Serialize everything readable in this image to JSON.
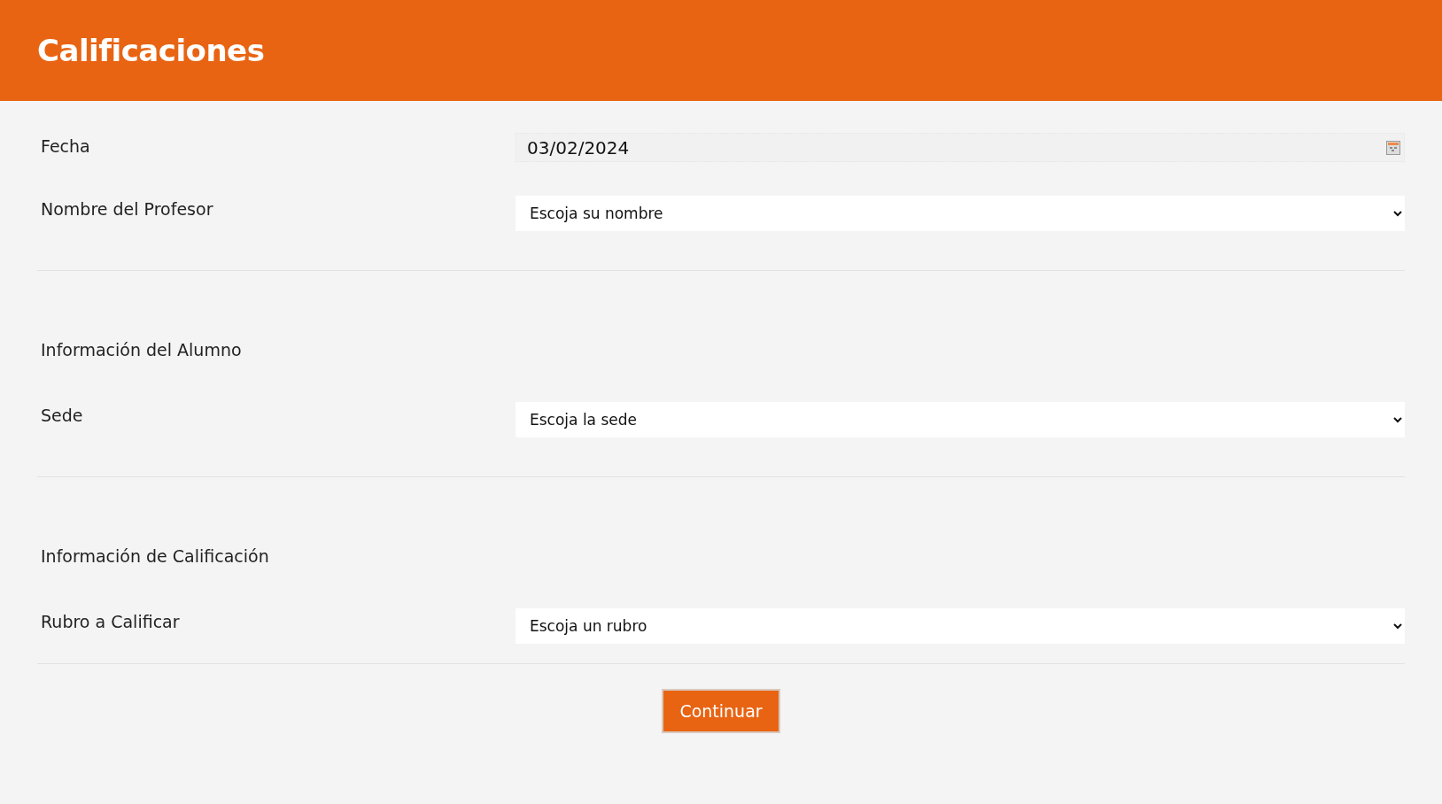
{
  "header": {
    "title": "Calificaciones"
  },
  "sections": [
    {
      "rows": [
        {
          "kind": "date",
          "label": "Fecha",
          "value": "03/02/2024"
        },
        {
          "kind": "select",
          "label": "Nombre del Profesor",
          "value": "Escoja su nombre"
        }
      ]
    },
    {
      "heading": "Información del Alumno",
      "rows": [
        {
          "kind": "select",
          "label": "Sede",
          "value": "Escoja la sede"
        }
      ]
    },
    {
      "heading": "Información de Calificación",
      "rows": [
        {
          "kind": "select",
          "label": "Rubro a Calificar",
          "value": "Escoja un rubro"
        }
      ]
    }
  ],
  "submit": {
    "label": "Continuar"
  }
}
